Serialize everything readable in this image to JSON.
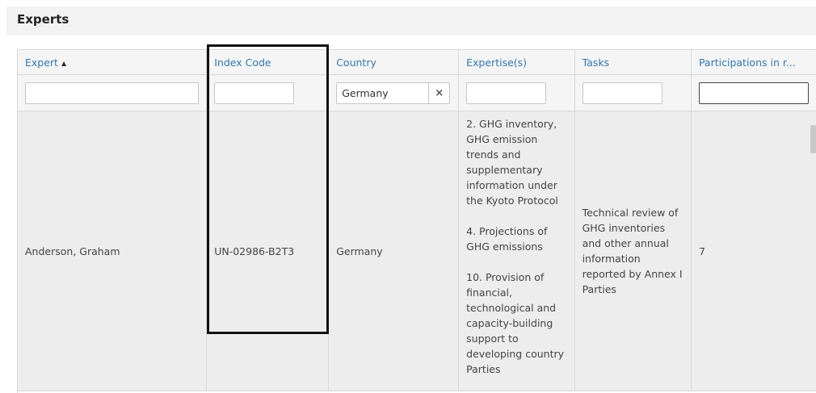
{
  "page": {
    "title": "Experts"
  },
  "columns": [
    {
      "label": "Expert",
      "sort": "▲"
    },
    {
      "label": "Index Code"
    },
    {
      "label": "Country"
    },
    {
      "label": "Expertise(s)"
    },
    {
      "label": "Tasks"
    },
    {
      "label": "Participations in r..."
    }
  ],
  "filters": {
    "expert": "",
    "index_code": "",
    "country": "Germany",
    "expertise": "",
    "tasks": "",
    "participations": "",
    "clear_icon": "×"
  },
  "rows": [
    {
      "expert": "Anderson, Graham",
      "index_code": "UN-02986-B2T3",
      "country": "Germany",
      "expertise": [
        "2. GHG inventory, GHG emission trends and supplementary information under the Kyoto Protocol",
        "4. Projections of GHG emissions",
        "10. Provision of financial, technological and capacity-building support to developing country Parties"
      ],
      "tasks": "Technical review of GHG inventories and other annual information reported by Annex I Parties",
      "participations": "7"
    }
  ]
}
